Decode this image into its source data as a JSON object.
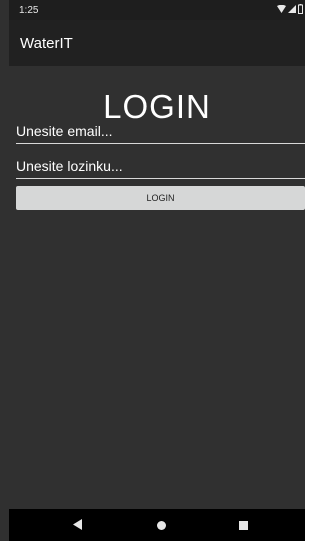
{
  "status_bar": {
    "time": "1:25",
    "icons": [
      "wifi-icon",
      "signal-icon",
      "battery-icon"
    ]
  },
  "app_bar": {
    "title": "WaterIT"
  },
  "main": {
    "heading": "LOGIN",
    "email_placeholder": "Unesite email...",
    "password_placeholder": "Unesite lozinku...",
    "login_button_label": "LOGIN"
  },
  "nav_bar": {
    "icons": [
      "back-icon",
      "home-icon",
      "recents-icon"
    ]
  },
  "colors": {
    "background": "#303030",
    "app_bar": "#212121",
    "status_bar": "#1e1e1e",
    "button": "#d6d7d7",
    "nav_bar": "#000000"
  }
}
